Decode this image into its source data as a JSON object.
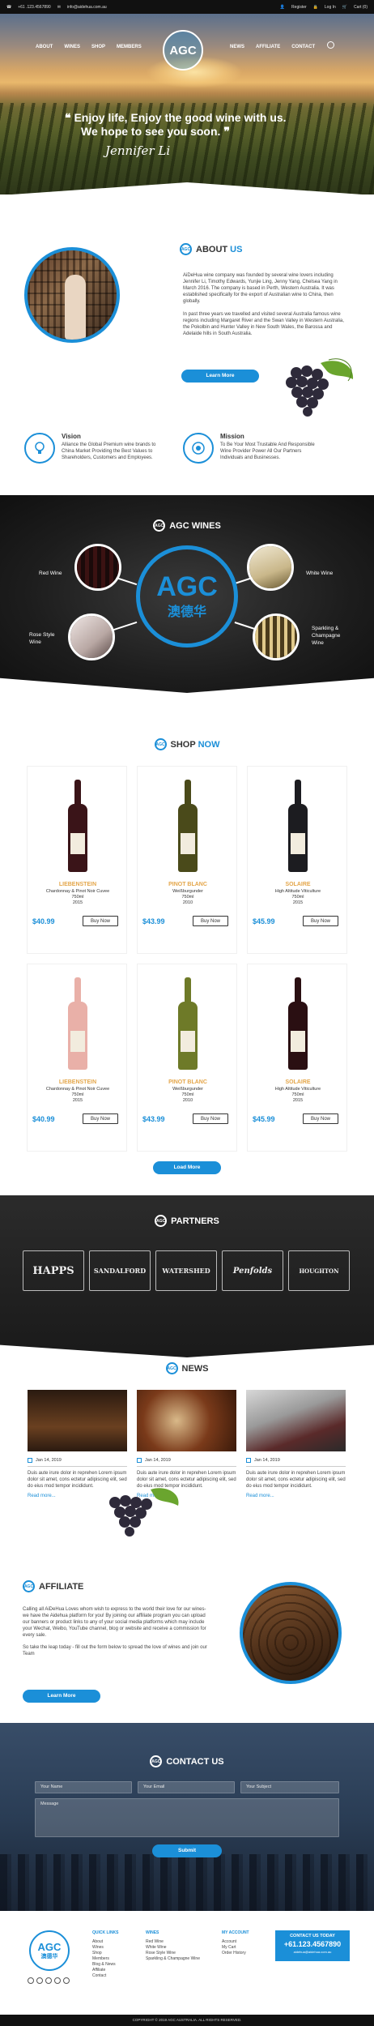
{
  "topbar": {
    "phone": "+61 .123.4567890",
    "email": "info@aidehua.com.au",
    "register": "Register",
    "login": "Log In",
    "cart": "Cart (0)"
  },
  "nav": {
    "left": [
      "ABOUT",
      "WINES",
      "SHOP",
      "MEMBERS"
    ],
    "right": [
      "NEWS",
      "AFFILIATE",
      "CONTACT"
    ],
    "logo": "AGC"
  },
  "hero": {
    "line1": "Enjoy life, Enjoy the good wine with us.",
    "line2": "We hope to see you soon.",
    "signature": "Jennifer Li"
  },
  "about": {
    "title_a": "ABOUT",
    "title_b": "US",
    "p1": "AiDeHua wine company was founded by several wine lovers including Jennifer Li, Timothy Edwards, Yunjie Ling, Jenny Yang, Chelsea Yang in March 2016. The company is based in Perth, Western Australia. It was established specifically for the export of Australian wine to China, then globally.",
    "p2": "In past three years we travelled and visited several Australia famous wine regions including Margaret River and the Swan Valley in Western Australia, the Pokolbin and Hunter Valley in New South Wales, the Barossa and Adelaide hills in South Australia.",
    "button": "Learn More"
  },
  "vision": {
    "title": "Vision",
    "text": "Alliance the Global Premium wine brands to China Market Providing the Best Values to Shareholders, Customers and Employees."
  },
  "mission": {
    "title": "Mission",
    "text": "To Be Your Most Trustable And Responsible Wine Provider Power All Our Partners Individuals and Businesses."
  },
  "wines": {
    "title": "AGC WINES",
    "logo_a": "AGC",
    "logo_b": "澳德华",
    "red": "Red Wine",
    "white": "White Wine",
    "rose_a": "Rose Style",
    "rose_b": "Wine",
    "sparkling_a": "Sparkling &",
    "sparkling_b": "Champagne",
    "sparkling_c": "Wine"
  },
  "shop": {
    "title_a": "SHOP",
    "title_b": "NOW",
    "products": [
      {
        "name": "LIEBENSTEIN",
        "desc": "Chardonnay & Pinot Noir Cuvee",
        "vol": "750ml",
        "year": "2015",
        "price": "$40.99",
        "buy": "Buy Now",
        "color": "#3a1418"
      },
      {
        "name": "PINOT BLANC",
        "desc": "Weißburgunder",
        "vol": "750ml",
        "year": "2010",
        "price": "$43.99",
        "buy": "Buy Now",
        "color": "#4a4a1a"
      },
      {
        "name": "SOLAIRE",
        "desc": "High Altitude Viticulture",
        "vol": "750ml",
        "year": "2015",
        "price": "$45.99",
        "buy": "Buy Now",
        "color": "#1c1c20"
      },
      {
        "name": "LIEBENSTEIN",
        "desc": "Chardonnay & Pinot Noir Cuvee",
        "vol": "750ml",
        "year": "2015",
        "price": "$40.99",
        "buy": "Buy Now",
        "color": "#e9b0a8"
      },
      {
        "name": "PINOT BLANC",
        "desc": "Weißburgunder",
        "vol": "750ml",
        "year": "2010",
        "price": "$43.99",
        "buy": "Buy Now",
        "color": "#6e7a28"
      },
      {
        "name": "SOLAIRE",
        "desc": "High Altitude Viticulture",
        "vol": "750ml",
        "year": "2015",
        "price": "$45.99",
        "buy": "Buy Now",
        "color": "#2a0f12"
      }
    ],
    "load_more": "Load More"
  },
  "partners": {
    "title": "PARTNERS",
    "logos": [
      "HAPPS",
      "SANDALFORD",
      "WATERSHED",
      "Penfolds",
      "HOUGHTON"
    ]
  },
  "news": {
    "title": "NEWS",
    "items": [
      {
        "date": "Jan 14, 2019",
        "text": "Duis aute irure dolor in reprehen Lorem ipsum dolor sit amet, cons ectetur adipiscing elit, sed do eius mod tempor incididunt.",
        "more": "Read more..."
      },
      {
        "date": "Jan 14, 2019",
        "text": "Duis aute irure dolor in reprehen Lorem ipsum dolor sit amet, cons ectetur adipiscing elit, sed do eius mod tempor incididunt.",
        "more": "Read more..."
      },
      {
        "date": "Jan 14, 2019",
        "text": "Duis aute irure dolor in reprehen Lorem ipsum dolor sit amet, cons ectetur adipiscing elit, sed do eius mod tempor incididunt.",
        "more": "Read more..."
      }
    ]
  },
  "affiliate": {
    "title": "AFFILIATE",
    "p1": "Calling all AiDeHua Loves whom wish to express to the world their love for our wines- we have the Aidehua platform for you! By joining our affiliate program you can upload our banners or product links to any of your social media platforms which may include your Wechat, Weibo, YouTube channel, blog or website and receive a commission for every sale.",
    "p2": "So take the leap today - fill out the form below to spread the love of wines and join our Team",
    "button": "Learn More"
  },
  "contact": {
    "title": "CONTACT US",
    "name": "Your Name",
    "email": "Your Email",
    "subject": "Your Subject",
    "message": "Message",
    "submit": "Submit"
  },
  "footer": {
    "logo_a": "AGC",
    "logo_b": "澳德华",
    "quick_links": {
      "title": "QUICK LINKS",
      "items": [
        "About",
        "Wines",
        "Shop",
        "Members",
        "Blog & News",
        "Affiliate",
        "Contact"
      ]
    },
    "wines": {
      "title": "WINES",
      "items": [
        "Red Wine",
        "White Wine",
        "Rose Style Wine",
        "Sparkling & Champagne Wine"
      ]
    },
    "account": {
      "title": "MY ACCOUNT",
      "items": [
        "Account",
        "My Cart",
        "Order History"
      ]
    },
    "contact_label": "CONTACT US TODAY",
    "phone": "+61.123.4567890",
    "email": "aidehua@aidehua.com.au",
    "copyright": "COPYRIGHT © 2019 AGC AUSTRALIA. ALL RIGHTS RESERVED."
  },
  "colors": {
    "accent": "#1b8fd8",
    "gold": "#e4a64a",
    "dark": "#1a1a1a"
  }
}
